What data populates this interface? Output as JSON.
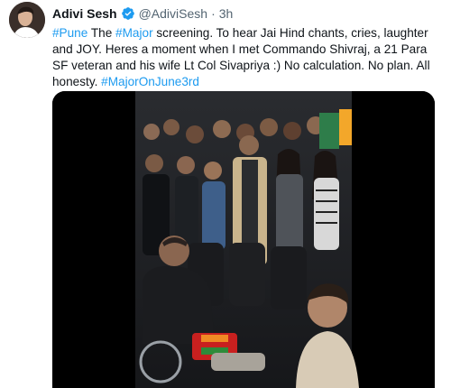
{
  "author": {
    "name": "Adivi Sesh",
    "handle": "@AdiviSesh",
    "separator": "·",
    "time": "3h"
  },
  "tweet": {
    "seg1": "#Pune",
    "seg2": " The ",
    "seg3": "#Major",
    "seg4": " screening. To hear Jai Hind chants, cries, laughter and JOY. Heres a moment when I met Commando Shivraj,  a 21 Para SF veteran and his wife Lt Col Sivapriya :) No calculation. No plan. All honesty. ",
    "seg5": "#MajorOnJune3rd"
  },
  "icons": {
    "verified": "verified-badge-icon",
    "avatar": "profile-avatar"
  },
  "colors": {
    "link": "#1d9bf0",
    "secondary": "#536471",
    "text": "#0f1419",
    "verified": "#1d9bf0"
  }
}
